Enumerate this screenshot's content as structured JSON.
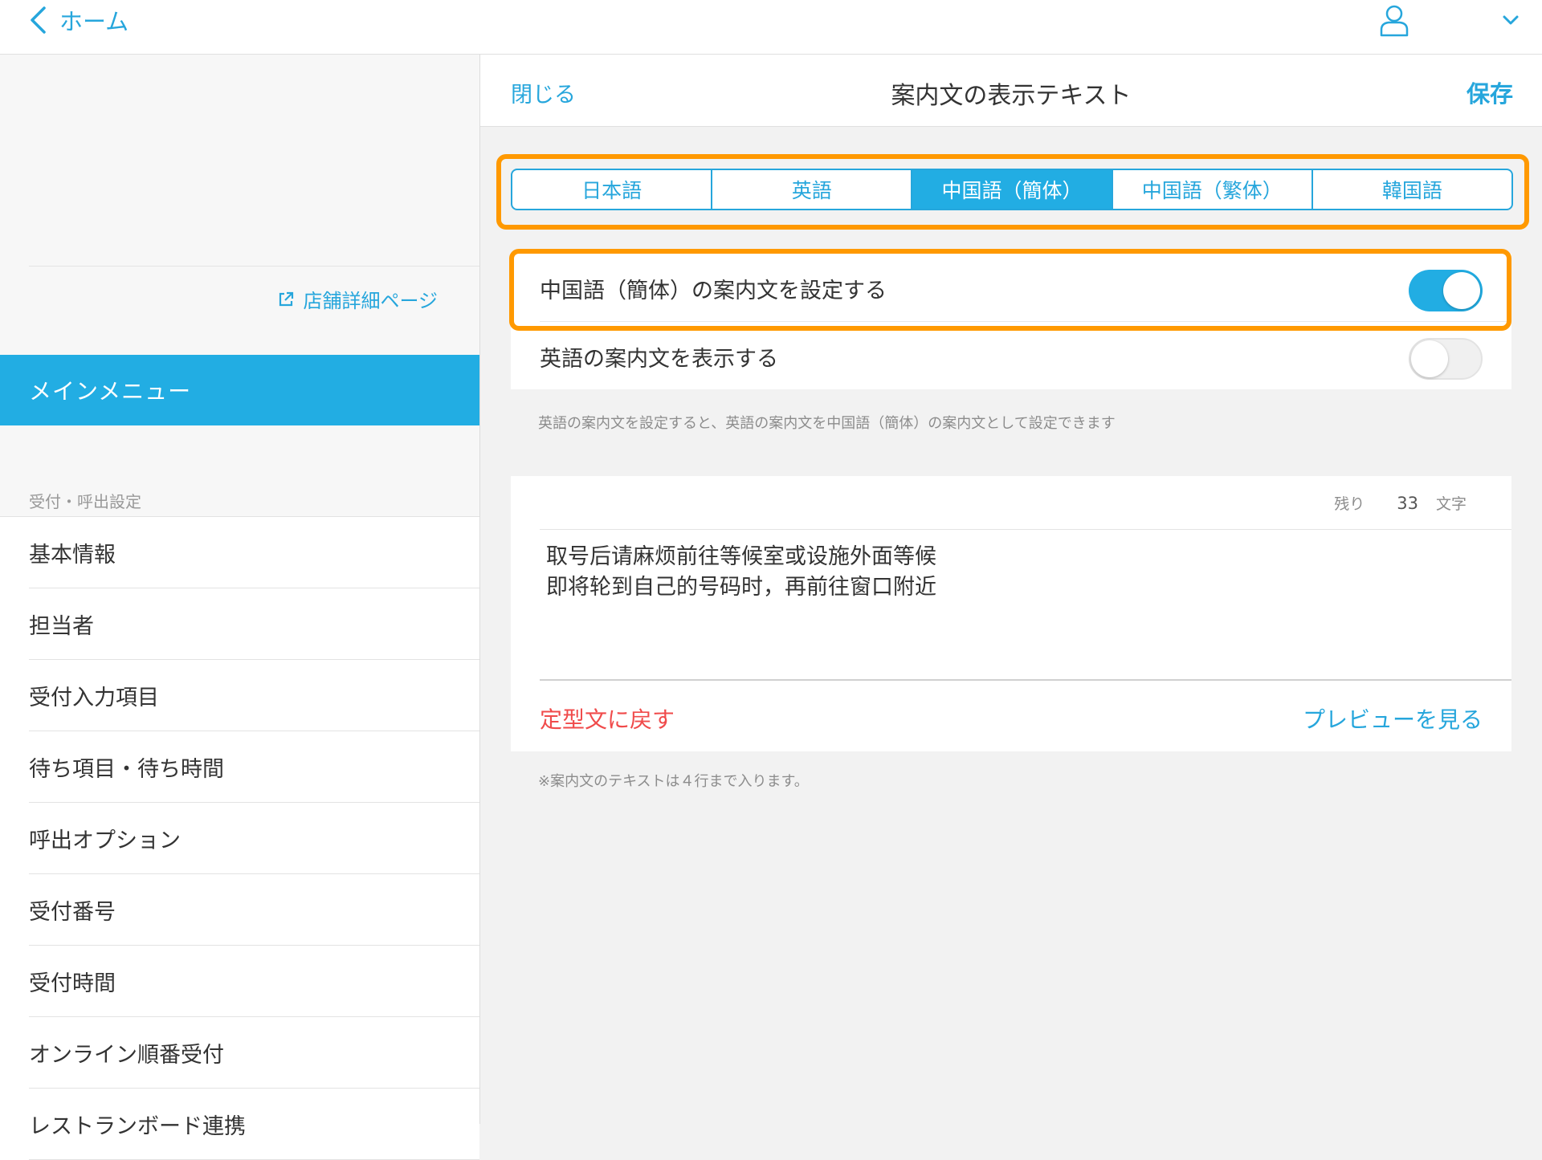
{
  "topbar": {
    "back_label": "ホーム",
    "icons": {
      "back": "chevron-left-icon",
      "user": "user-icon",
      "dropdown": "chevron-down-icon"
    }
  },
  "sidebar": {
    "store_link": "店舗詳細ページ",
    "main_menu": "メインメニュー",
    "section_label": "受付・呼出設定",
    "items": [
      {
        "label": "基本情報"
      },
      {
        "label": "担当者"
      },
      {
        "label": "受付入力項目"
      },
      {
        "label": "待ち項目・待ち時間"
      },
      {
        "label": "呼出オプション"
      },
      {
        "label": "受付番号"
      },
      {
        "label": "受付時間"
      },
      {
        "label": "オンライン順番受付"
      },
      {
        "label": "レストランボード連携"
      }
    ]
  },
  "navbar": {
    "close_label": "閉じる",
    "title": "案内文の表示テキスト",
    "save_label": "保存"
  },
  "tabs": [
    {
      "label": "日本語",
      "active": false
    },
    {
      "label": "英語",
      "active": false
    },
    {
      "label": "中国語（簡体）",
      "active": true
    },
    {
      "label": "中国語（繁体）",
      "active": false
    },
    {
      "label": "韓国語",
      "active": false
    }
  ],
  "settings": {
    "set_text_label": "中国語（簡体）の案内文を設定する",
    "set_text_on": true,
    "show_english_label": "英語の案内文を表示する",
    "show_english_on": false,
    "hint": "英語の案内文を設定すると、英語の案内文を中国語（簡体）の案内文として設定できます"
  },
  "editor": {
    "remaining_label": "残り",
    "remaining_count": "33",
    "remaining_unit": "文字",
    "lines": [
      "取号后请麻烦前往等候室或设施外面等候",
      "即将轮到自己的号码时，再前往窗口附近"
    ],
    "reset_label": "定型文に戻す",
    "preview_label": "プレビューを見る"
  },
  "note": "※案内文のテキストは４行まで入ります。",
  "colors": {
    "accent": "#22ade3",
    "link": "#26a6dc",
    "highlight": "#ff9900",
    "danger": "#f04b4b"
  }
}
